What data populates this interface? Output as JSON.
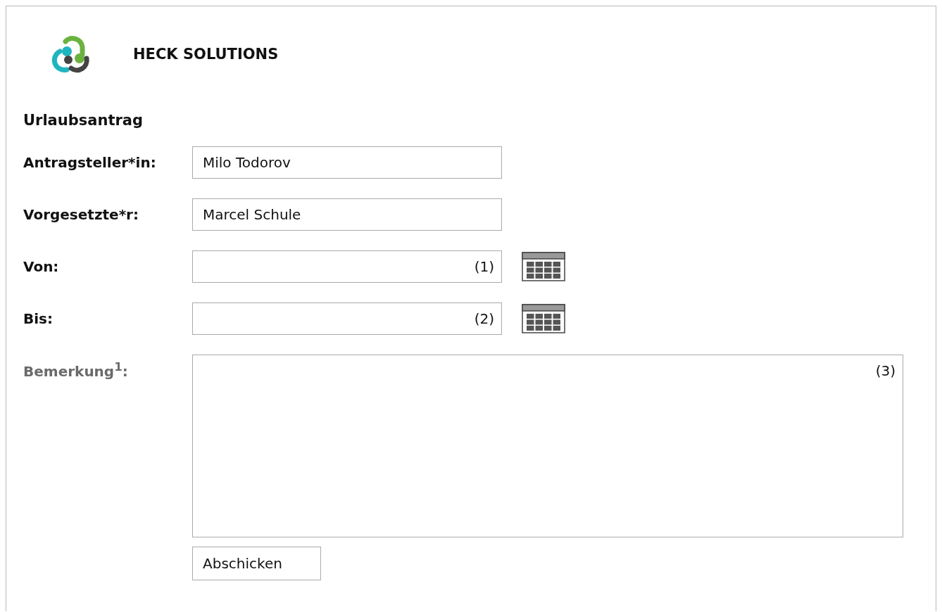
{
  "brand": {
    "name": "HECK SOLUTIONS"
  },
  "form": {
    "title": "Urlaubsantrag",
    "fields": [
      {
        "kind": "text",
        "label": "Antragsteller*in:",
        "value": "Milo Todorov",
        "optional": false
      },
      {
        "kind": "text",
        "label": "Vorgesetzte*r:",
        "value": "Marcel Schule",
        "optional": false
      },
      {
        "kind": "date",
        "label": "Von:",
        "hint": "(1)",
        "optional": false
      },
      {
        "kind": "date",
        "label": "Bis:",
        "hint": "(2)",
        "optional": false
      },
      {
        "kind": "textarea",
        "label": "Bemerkung$^{1}$:",
        "hint": "(3)",
        "optional": true
      }
    ],
    "submit": "Abschicken"
  }
}
